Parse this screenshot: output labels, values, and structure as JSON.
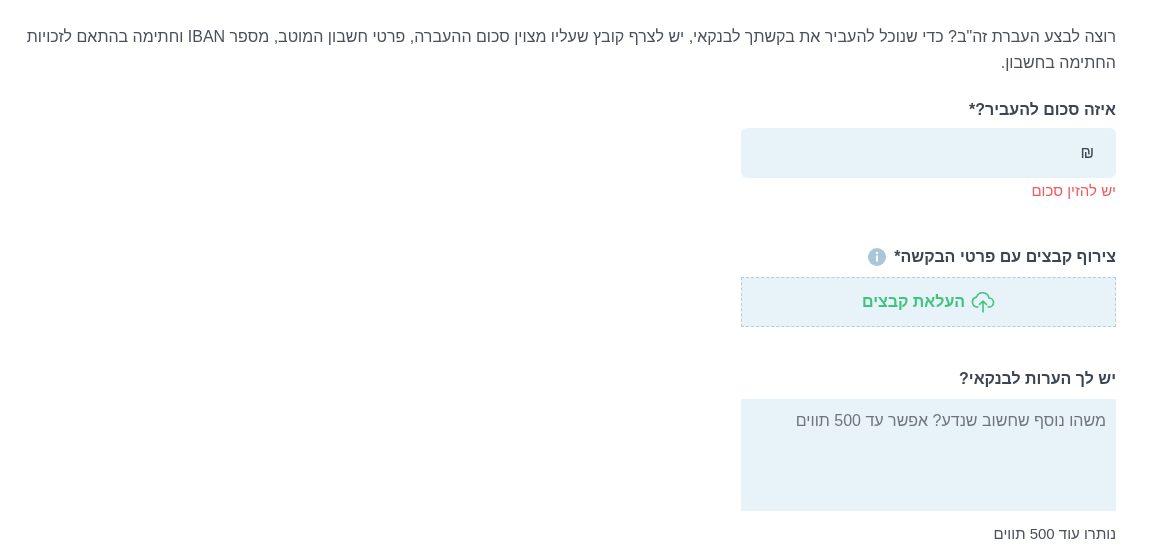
{
  "intro": "רוצה לבצע העברת זה\"ב? כדי שנוכל להעביר את בקשתך לבנקאי, יש לצרף קובץ שעליו מצוין סכום ההעברה, פרטי חשבון המוטב, מספר IBAN וחתימה בהתאם לזכויות החתימה בחשבון.",
  "amount": {
    "label": "איזה סכום להעביר?*",
    "currency": "₪",
    "error": "יש להזין סכום"
  },
  "attachments": {
    "label": "צירוף קבצים עם פרטי הבקשה*",
    "upload_button": "העלאת קבצים"
  },
  "notes": {
    "label": "יש לך הערות לבנקאי?",
    "placeholder": "משהו נוסף שחשוב שנדע? אפשר עד 500 תווים",
    "counter": "נותרו עוד 500 תווים"
  }
}
